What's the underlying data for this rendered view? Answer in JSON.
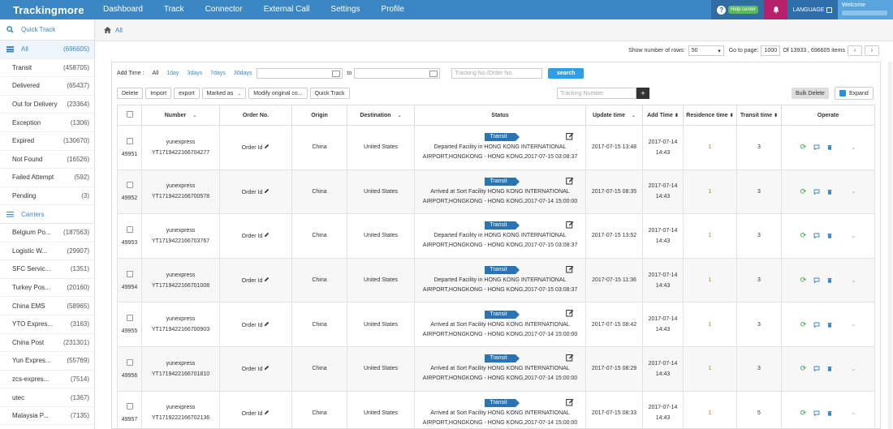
{
  "brand": "Trackingmore",
  "nav": [
    "Dashboard",
    "Track",
    "Connector",
    "External Call",
    "Settings",
    "Profile"
  ],
  "topright": {
    "help_label": "Help center",
    "language_label": "LANGUAGE",
    "welcome_label": "Welcome"
  },
  "sidebar": {
    "quick_track": "Quick Track",
    "statuses": [
      {
        "label": "All",
        "count": "(696605)"
      },
      {
        "label": "Transit",
        "count": "(458705)"
      },
      {
        "label": "Delivered",
        "count": "(65437)"
      },
      {
        "label": "Out for Delivery",
        "count": "(23364)"
      },
      {
        "label": "Exception",
        "count": "(1306)"
      },
      {
        "label": "Expired",
        "count": "(130670)"
      },
      {
        "label": "Not Found",
        "count": "(16526)"
      },
      {
        "label": "Failed Attempt",
        "count": "(592)"
      },
      {
        "label": "Pending",
        "count": "(3)"
      }
    ],
    "carriers_title": "Carriers",
    "carriers": [
      {
        "label": "Belgium Po...",
        "count": "(187563)"
      },
      {
        "label": "Logistic W...",
        "count": "(29907)"
      },
      {
        "label": "SFC Servic...",
        "count": "(1351)"
      },
      {
        "label": "Turkey Pos...",
        "count": "(20160)"
      },
      {
        "label": "China EMS",
        "count": "(58965)"
      },
      {
        "label": "YTO Expres...",
        "count": "(3163)"
      },
      {
        "label": "China Post",
        "count": "(231301)"
      },
      {
        "label": "Yun Expres...",
        "count": "(55769)"
      },
      {
        "label": "zcs-expres...",
        "count": "(7514)"
      },
      {
        "label": "utec",
        "count": "(1367)"
      },
      {
        "label": "Malaysia P...",
        "count": "(7135)"
      }
    ]
  },
  "breadcrumb": "All",
  "pager": {
    "rows_label": "Show number of rows:",
    "rows_value": "50",
    "goto_label": "Go to page:",
    "page_value": "1000",
    "total_text": "Of 13933 , 696605 items"
  },
  "filter": {
    "add_time_label": "Add Time :",
    "ranges": [
      "All",
      "1day",
      "3days",
      "7days",
      "30days"
    ],
    "to_label": "to",
    "tracking_placeholder": "Tracking No./Order No.",
    "search_label": "search"
  },
  "actions": [
    "Delete",
    "Import",
    "export",
    "Marked as",
    "Modify original co...",
    "Quick Track"
  ],
  "tracking_number_placeholder": "Tracking Number",
  "bulk_delete": "Bulk Delete",
  "expand": "Expand",
  "columns": {
    "number": "Number",
    "order_no": "Order No.",
    "origin": "Origin",
    "destination": "Destination",
    "status": "Status",
    "update_time": "Update time",
    "add_time": "Add Time",
    "residence_time": "Residence time",
    "transit_time": "Transit time",
    "operate": "Operate"
  },
  "rows": [
    {
      "id": "49951",
      "carrier": "yunexpress",
      "number": "YT1719422166704277",
      "order": "Order Id",
      "origin": "China",
      "dest": "United States",
      "tag": "Transit",
      "status_line1": "Departed Facility in HONG KONG INTERNATIONAL",
      "status_line2": "AIRPORT,HONGKONG - HONG KONG,2017-07-15 03:08:37",
      "update": "2017-07-15 13:48",
      "add_date": "2017-07-14",
      "add_time": "14:43",
      "residence": "1",
      "transit": "3"
    },
    {
      "id": "49952",
      "carrier": "yunexpress",
      "number": "YT1719422166700578",
      "order": "Order Id",
      "origin": "China",
      "dest": "United States",
      "tag": "Transit",
      "status_line1": "Arrived at Sort Facility HONG KONG INTERNATIONAL",
      "status_line2": "AIRPORT,HONGKONG - HONG KONG,2017-07-14 15:00:00",
      "update": "2017-07-15 08:35",
      "add_date": "2017-07-14",
      "add_time": "14:43",
      "residence": "1",
      "transit": "3"
    },
    {
      "id": "49953",
      "carrier": "yunexpress",
      "number": "YT1719422166703767",
      "order": "Order Id",
      "origin": "China",
      "dest": "United States",
      "tag": "Transit",
      "status_line1": "Departed Facility in HONG KONG INTERNATIONAL",
      "status_line2": "AIRPORT,HONGKONG - HONG KONG,2017-07-15 03:08:37",
      "update": "2017-07-15 13:52",
      "add_date": "2017-07-14",
      "add_time": "14:43",
      "residence": "1",
      "transit": "3"
    },
    {
      "id": "49954",
      "carrier": "yunexpress",
      "number": "YT1719422166701008",
      "order": "Order Id",
      "origin": "China",
      "dest": "United States",
      "tag": "Transit",
      "status_line1": "Departed Facility in HONG KONG INTERNATIONAL",
      "status_line2": "AIRPORT,HONGKONG - HONG KONG,2017-07-15 03:08:37",
      "update": "2017-07-15 11:36",
      "add_date": "2017-07-14",
      "add_time": "14:43",
      "residence": "1",
      "transit": "3"
    },
    {
      "id": "49955",
      "carrier": "yunexpress",
      "number": "YT1719422166700903",
      "order": "Order Id",
      "origin": "China",
      "dest": "United States",
      "tag": "Transit",
      "status_line1": "Arrived at Sort Facility HONG KONG INTERNATIONAL",
      "status_line2": "AIRPORT,HONGKONG - HONG KONG,2017-07-14 15:00:00",
      "update": "2017-07-15 08:42",
      "add_date": "2017-07-14",
      "add_time": "14:43",
      "residence": "1",
      "transit": "3"
    },
    {
      "id": "49956",
      "carrier": "yunexpress",
      "number": "YT1719422166701810",
      "order": "Order Id",
      "origin": "China",
      "dest": "United States",
      "tag": "Transit",
      "status_line1": "Arrived at Sort Facility HONG KONG INTERNATIONAL",
      "status_line2": "AIRPORT,HONGKONG - HONG KONG,2017-07-14 15:00:00",
      "update": "2017-07-15 08:29",
      "add_date": "2017-07-14",
      "add_time": "14:43",
      "residence": "1",
      "transit": "3"
    },
    {
      "id": "49957",
      "carrier": "yunexpress",
      "number": "YT1719222166702136",
      "order": "Order Id",
      "origin": "China",
      "dest": "United States",
      "tag": "Transit",
      "status_line1": "Arrived at Sort Facility HONG KONG INTERNATIONAL",
      "status_line2": "AIRPORT,HONGKONG - HONG KONG,2017-07-14 15:00:00",
      "update": "2017-07-15 08:33",
      "add_date": "2017-07-14",
      "add_time": "14:43",
      "residence": "1",
      "transit": "5"
    }
  ]
}
